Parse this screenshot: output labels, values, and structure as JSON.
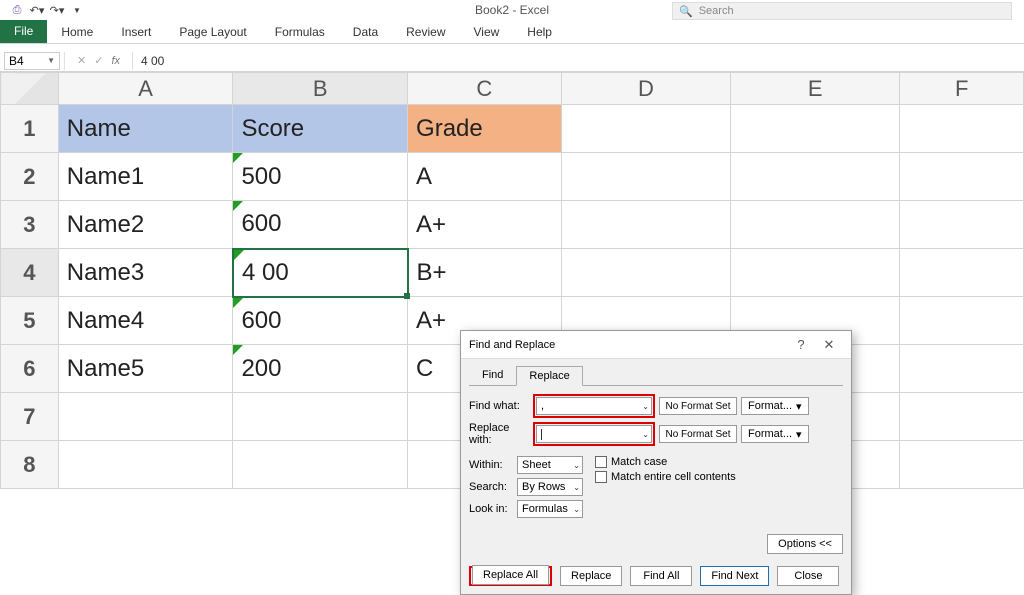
{
  "app": {
    "title": "Book2 - Excel",
    "search_placeholder": "Search"
  },
  "qat": {
    "save": "💾",
    "undo": "↶",
    "redo": "↷"
  },
  "ribbon": {
    "file": "File",
    "tabs": [
      "Home",
      "Insert",
      "Page Layout",
      "Formulas",
      "Data",
      "Review",
      "View",
      "Help"
    ]
  },
  "formula_bar": {
    "name_box": "B4",
    "value": "4 00"
  },
  "columns": [
    "A",
    "B",
    "C",
    "D",
    "E",
    "F"
  ],
  "rows": [
    "1",
    "2",
    "3",
    "4",
    "5",
    "6",
    "7",
    "8"
  ],
  "sheet": {
    "headers": {
      "A": "Name",
      "B": "Score",
      "C": "Grade"
    },
    "data": [
      {
        "A": "Name1",
        "B": "500",
        "C": "A"
      },
      {
        "A": "Name2",
        "B": "600",
        "C": "A+"
      },
      {
        "A": "Name3",
        "B": "4 00",
        "C": "B+"
      },
      {
        "A": "Name4",
        "B": "600",
        "C": "A+"
      },
      {
        "A": "Name5",
        "B": "200",
        "C": "C"
      }
    ]
  },
  "dialog": {
    "title": "Find and Replace",
    "tabs": {
      "find": "Find",
      "replace": "Replace"
    },
    "find_what_label": "Find what:",
    "find_what_value": ",",
    "replace_with_label": "Replace with:",
    "replace_with_value": "",
    "no_format": "No Format Set",
    "format_btn": "Format...",
    "within_label": "Within:",
    "within_value": "Sheet",
    "search_label": "Search:",
    "search_value": "By Rows",
    "lookin_label": "Look in:",
    "lookin_value": "Formulas",
    "match_case": "Match case",
    "match_entire": "Match entire cell contents",
    "options_btn": "Options <<",
    "buttons": {
      "replace_all": "Replace All",
      "replace": "Replace",
      "find_all": "Find All",
      "find_next": "Find Next",
      "close": "Close"
    }
  }
}
